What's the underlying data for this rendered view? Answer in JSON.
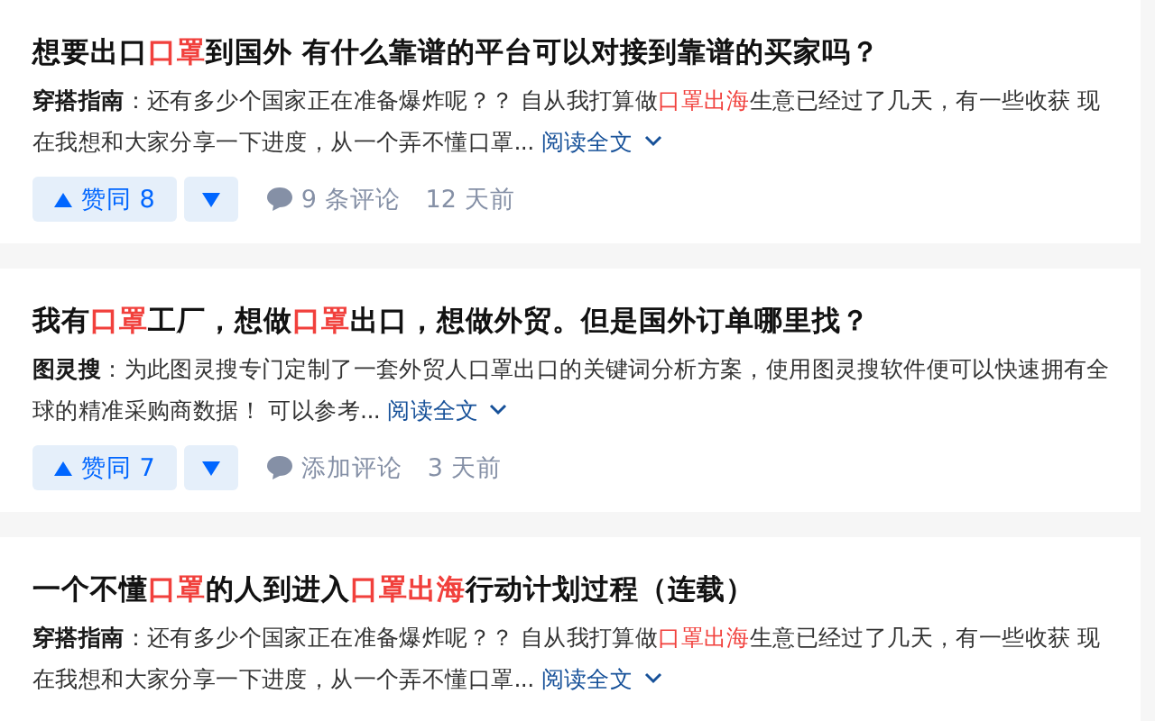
{
  "results": [
    {
      "title": [
        {
          "text": "想要出口",
          "highlight": false
        },
        {
          "text": "口罩",
          "highlight": true
        },
        {
          "text": "到国外 有什么靠谱的平台可以对接到靠谱的买家吗？",
          "highlight": false
        }
      ],
      "excerpt": {
        "author": "穿搭指南",
        "segments": [
          {
            "text": "：还有多少个国家正在准备爆炸呢？？ 自从我打算做",
            "highlight": false
          },
          {
            "text": "口罩出海",
            "highlight": true
          },
          {
            "text": "生意已经过了几天，有一些收获 现在我想和大家分享一下进度，从一个弄不懂口罩...",
            "highlight": false
          }
        ],
        "read_more": "阅读全文"
      },
      "upvote": "赞同 8",
      "comments": "9 条评论",
      "time": "12 天前"
    },
    {
      "title": [
        {
          "text": "我有",
          "highlight": false
        },
        {
          "text": "口罩",
          "highlight": true
        },
        {
          "text": "工厂，想做",
          "highlight": false
        },
        {
          "text": "口罩",
          "highlight": true
        },
        {
          "text": "出口，想做外贸。但是国外订单哪里找？",
          "highlight": false
        }
      ],
      "excerpt": {
        "author": "图灵搜",
        "segments": [
          {
            "text": "：为此图灵搜专门定制了一套外贸人口罩出口的关键词分析方案，使用图灵搜软件便可以快速拥有全球的精准采购商数据！ 可以参考...",
            "highlight": false
          }
        ],
        "read_more": "阅读全文"
      },
      "upvote": "赞同 7",
      "comments": "添加评论",
      "time": "3 天前"
    },
    {
      "title": [
        {
          "text": "一个不懂",
          "highlight": false
        },
        {
          "text": "口罩",
          "highlight": true
        },
        {
          "text": "的人到进入",
          "highlight": false
        },
        {
          "text": "口罩出海",
          "highlight": true
        },
        {
          "text": "行动计划过程（连载）",
          "highlight": false
        }
      ],
      "excerpt": {
        "author": "穿搭指南",
        "segments": [
          {
            "text": "：还有多少个国家正在准备爆炸呢？？ 自从我打算做",
            "highlight": false
          },
          {
            "text": "口罩出海",
            "highlight": true
          },
          {
            "text": "生意已经过了几天，有一些收获 现在我想和大家分享一下进度，从一个弄不懂口罩...",
            "highlight": false
          }
        ],
        "read_more": "阅读全文"
      }
    }
  ]
}
